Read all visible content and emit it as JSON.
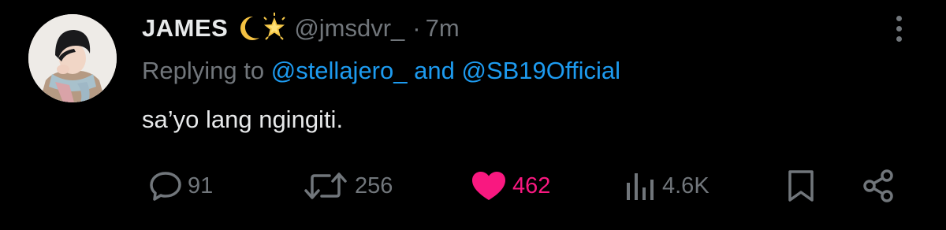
{
  "tweet": {
    "display_name": "JAMES",
    "emoji": [
      "crescent-moon",
      "glowing-star"
    ],
    "handle": "@jmsdvr_",
    "separator": "·",
    "time": "7m",
    "replying_prefix": "Replying to",
    "replying_mentions": [
      "@stellajero_",
      "@SB19Official"
    ],
    "replying_joiner": "and",
    "text": "sa’yo lang ngingiti."
  },
  "actions": {
    "replies": "91",
    "retweets": "256",
    "likes": "462",
    "views": "4.6K"
  },
  "icons": {
    "reply": "speech-bubble-icon",
    "retweet": "retweet-icon",
    "like": "heart-icon",
    "views": "bar-chart-icon",
    "bookmark": "bookmark-icon",
    "share": "share-icon",
    "more": "more-vertical-icon"
  },
  "colors": {
    "background": "#000000",
    "text": "#e7e9ea",
    "muted": "#71767b",
    "link": "#1d9bf0",
    "like": "#f91880"
  }
}
